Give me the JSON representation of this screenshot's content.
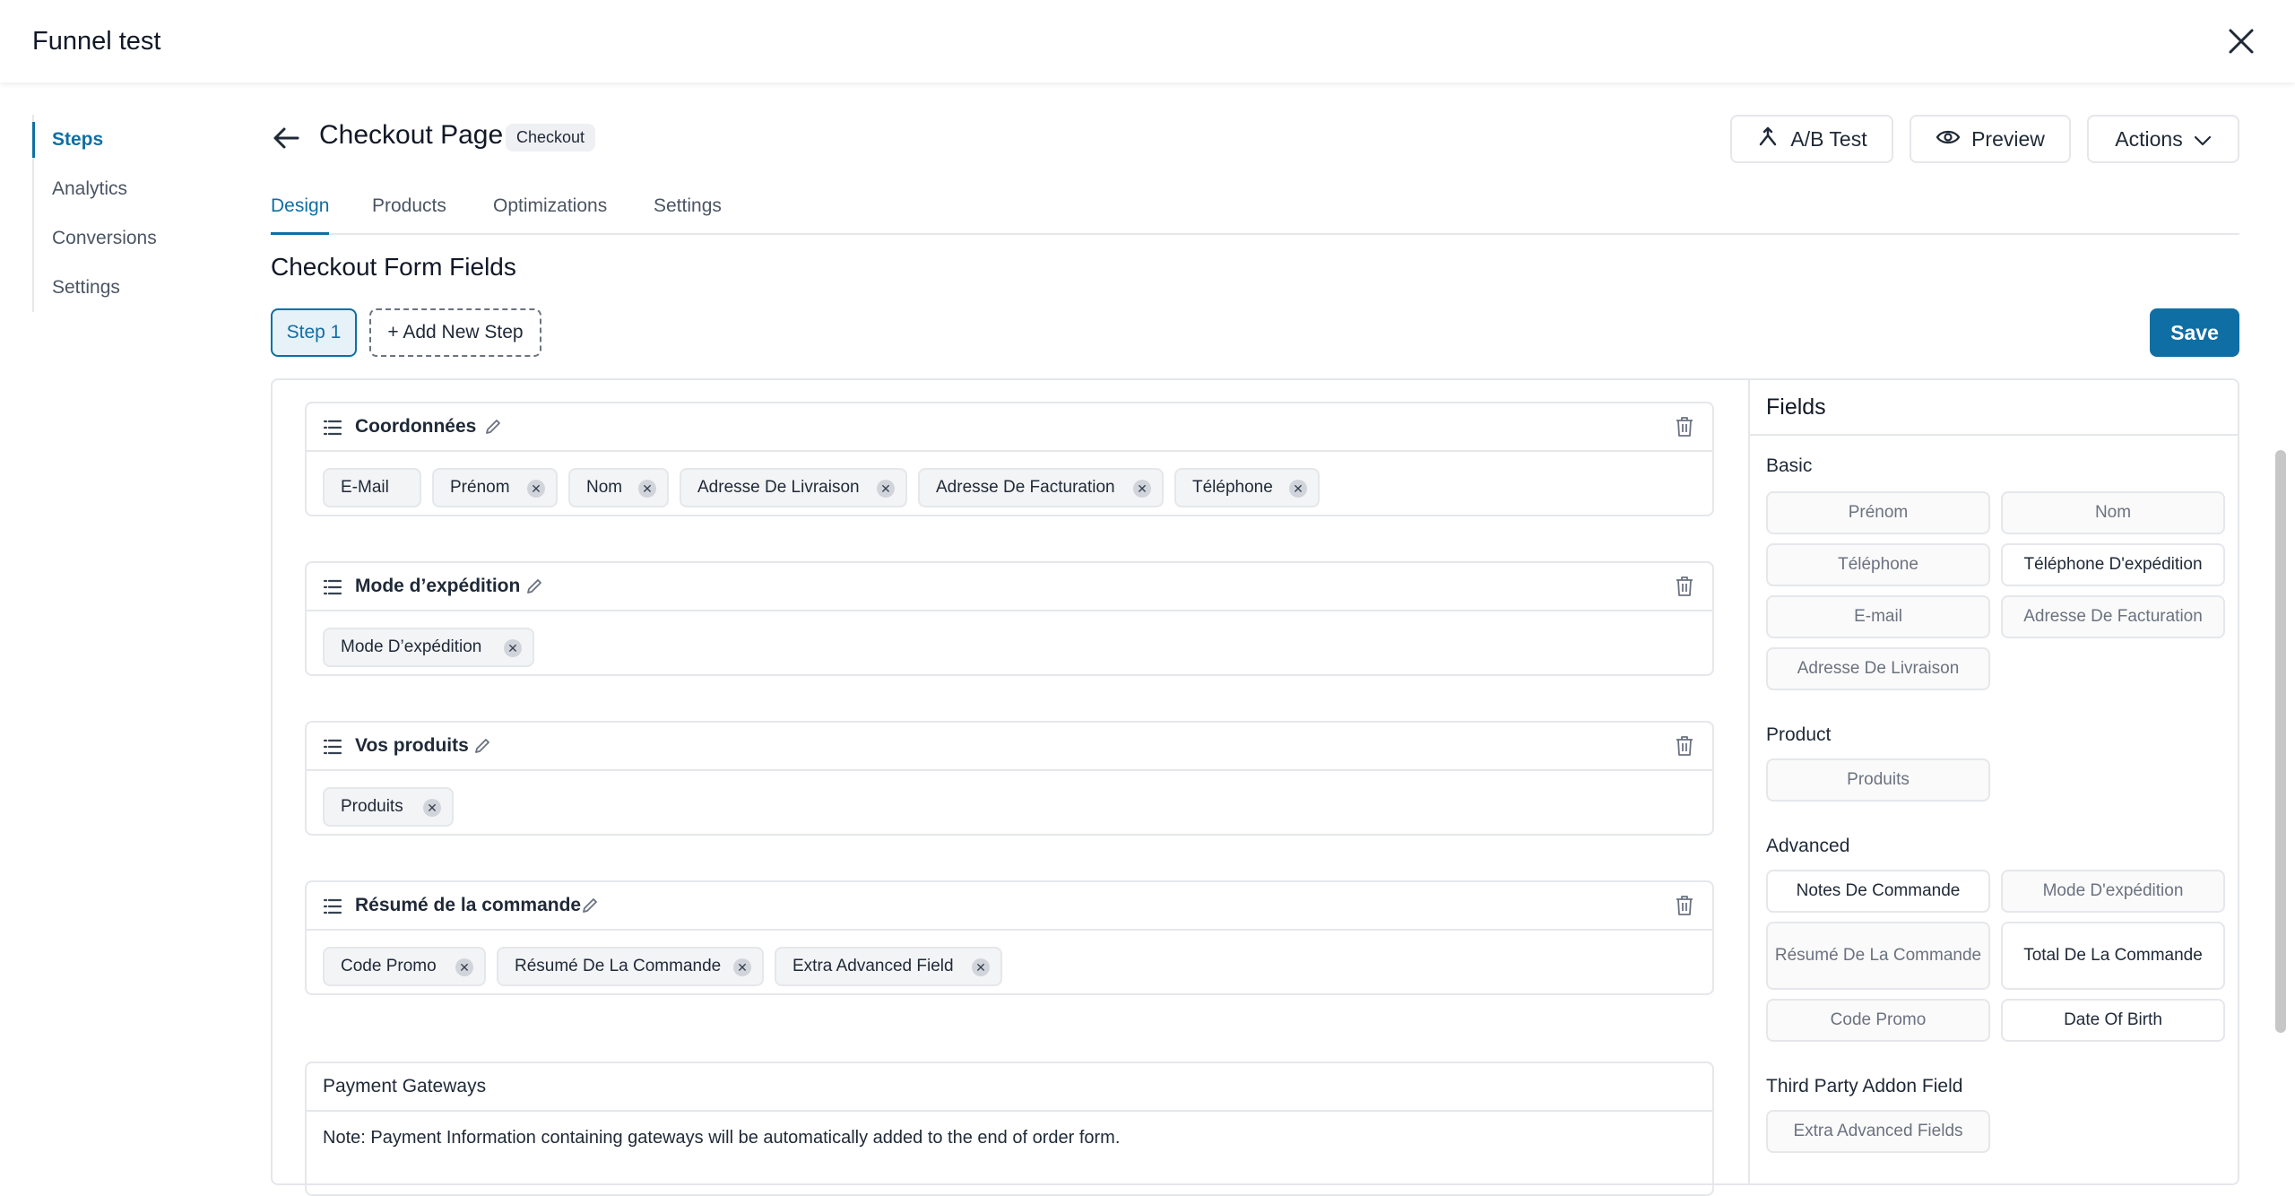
{
  "app": {
    "title": "Funnel test"
  },
  "sidebar": {
    "items": [
      {
        "label": "Steps"
      },
      {
        "label": "Analytics"
      },
      {
        "label": "Conversions"
      },
      {
        "label": "Settings"
      }
    ]
  },
  "page": {
    "title": "Checkout Page",
    "badge": "Checkout",
    "ab_test_label": "A/B Test",
    "preview_label": "Preview",
    "actions_label": "Actions"
  },
  "tabs": [
    {
      "label": "Design"
    },
    {
      "label": "Products"
    },
    {
      "label": "Optimizations"
    },
    {
      "label": "Settings"
    }
  ],
  "form": {
    "title": "Checkout Form Fields",
    "step_label": "Step 1",
    "add_step_label": "+ Add New Step",
    "save_label": "Save"
  },
  "sections": [
    {
      "title": "Coordonnées",
      "fields": [
        "E-Mail",
        "Prénom",
        "Nom",
        "Adresse De Livraison",
        "Adresse De Facturation",
        "Téléphone"
      ]
    },
    {
      "title": "Mode d’expédition",
      "fields": [
        "Mode D’expédition"
      ]
    },
    {
      "title": "Vos produits",
      "fields": [
        "Produits"
      ]
    },
    {
      "title": "Résumé de la commande",
      "fields": [
        "Code Promo",
        "Résumé De La Commande",
        "Extra Advanced Field"
      ]
    }
  ],
  "payment": {
    "title": "Payment Gateways",
    "note": "Note: Payment Information containing gateways will be automatically added to the end of order form."
  },
  "fields_panel": {
    "title": "Fields",
    "groups": {
      "basic": {
        "title": "Basic",
        "items": [
          "Prénom",
          "Nom",
          "Téléphone",
          "Téléphone D'expédition",
          "E-mail",
          "Adresse De Facturation",
          "Adresse De Livraison"
        ]
      },
      "product": {
        "title": "Product",
        "items": [
          "Produits"
        ]
      },
      "advanced": {
        "title": "Advanced",
        "items": [
          "Notes De Commande",
          "Mode D'expédition",
          "Résumé De La Commande",
          "Total De La Commande",
          "Code Promo",
          "Date Of Birth"
        ]
      },
      "third_party": {
        "title": "Third Party Addon Field",
        "items": [
          "Extra Advanced Fields"
        ]
      }
    }
  },
  "colors": {
    "accent": "#0f6fa4",
    "border": "#e5e7eb"
  }
}
